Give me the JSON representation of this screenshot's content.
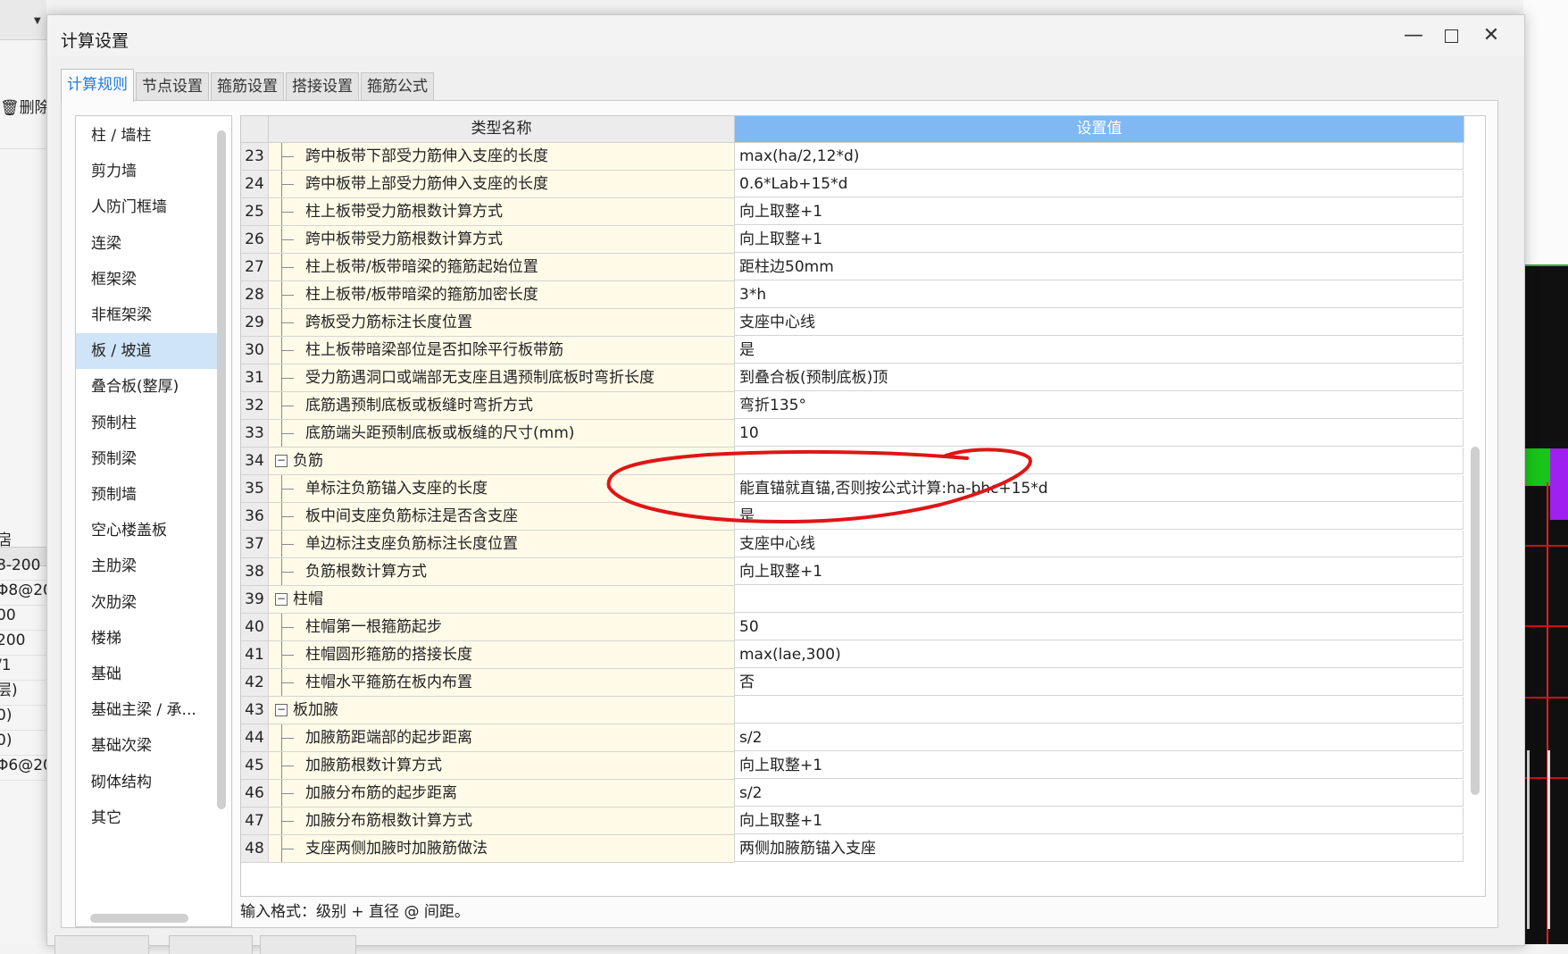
{
  "background": {
    "delete_label": "删除",
    "left_rows": [
      "扂",
      "8-200",
      "Φ8@20",
      "00",
      "200",
      "/1",
      "层)",
      "0)",
      "0)",
      "Φ6@20"
    ],
    "colors": {
      "dark": "#101010",
      "green": "#19c419",
      "purple": "#a020f0",
      "red": "#e02020"
    }
  },
  "dialog": {
    "title": "计算设置",
    "window_buttons": {
      "minimize": "—",
      "close": "✕"
    },
    "tabs": [
      {
        "label": "计算规则",
        "active": true
      },
      {
        "label": "节点设置"
      },
      {
        "label": "箍筋设置"
      },
      {
        "label": "搭接设置"
      },
      {
        "label": "箍筋公式"
      }
    ],
    "nav": {
      "items": [
        "柱 / 墙柱",
        "剪力墙",
        "人防门框墙",
        "连梁",
        "框架梁",
        "非框架梁",
        "板 / 坡道",
        "叠合板(整厚)",
        "预制柱",
        "预制梁",
        "预制墙",
        "空心楼盖板",
        "主肋梁",
        "次肋梁",
        "楼梯",
        "基础",
        "基础主梁 / 承...",
        "基础次梁",
        "砌体结构",
        "其它"
      ],
      "active_index": 6
    },
    "grid": {
      "headers": {
        "num": "",
        "name": "类型名称",
        "value": "设置值"
      },
      "rows": [
        {
          "num": "23",
          "name": "跨中板带下部受力筋伸入支座的长度",
          "value": "max(ha/2,12*d)"
        },
        {
          "num": "24",
          "name": "跨中板带上部受力筋伸入支座的长度",
          "value": "0.6*Lab+15*d"
        },
        {
          "num": "25",
          "name": "柱上板带受力筋根数计算方式",
          "value": "向上取整+1"
        },
        {
          "num": "26",
          "name": "跨中板带受力筋根数计算方式",
          "value": "向上取整+1"
        },
        {
          "num": "27",
          "name": "柱上板带/板带暗梁的箍筋起始位置",
          "value": "距柱边50mm"
        },
        {
          "num": "28",
          "name": "柱上板带/板带暗梁的箍筋加密长度",
          "value": "3*h"
        },
        {
          "num": "29",
          "name": "跨板受力筋标注长度位置",
          "value": "支座中心线"
        },
        {
          "num": "30",
          "name": "柱上板带暗梁部位是否扣除平行板带筋",
          "value": "是"
        },
        {
          "num": "31",
          "name": "受力筋遇洞口或端部无支座且遇预制底板时弯折长度",
          "value": "到叠合板(预制底板)顶"
        },
        {
          "num": "32",
          "name": "底筋遇预制底板或板缝时弯折方式",
          "value": "弯折135°"
        },
        {
          "num": "33",
          "name": "底筋端头距预制底板或板缝的尺寸(mm)",
          "value": "10"
        },
        {
          "num": "34",
          "name": "负筋",
          "value": "",
          "group": true
        },
        {
          "num": "35",
          "name": "单标注负筋锚入支座的长度",
          "value": "能直锚就直锚,否则按公式计算:ha-bhc+15*d"
        },
        {
          "num": "36",
          "name": "板中间支座负筋标注是否含支座",
          "value": "是"
        },
        {
          "num": "37",
          "name": "单边标注支座负筋标注长度位置",
          "value": "支座中心线"
        },
        {
          "num": "38",
          "name": "负筋根数计算方式",
          "value": "向上取整+1"
        },
        {
          "num": "39",
          "name": "柱帽",
          "value": "",
          "group": true
        },
        {
          "num": "40",
          "name": "柱帽第一根箍筋起步",
          "value": "50"
        },
        {
          "num": "41",
          "name": "柱帽圆形箍筋的搭接长度",
          "value": "max(lae,300)"
        },
        {
          "num": "42",
          "name": "柱帽水平箍筋在板内布置",
          "value": "否"
        },
        {
          "num": "43",
          "name": "板加腋",
          "value": "",
          "group": true
        },
        {
          "num": "44",
          "name": "加腋筋距端部的起步距离",
          "value": "s/2"
        },
        {
          "num": "45",
          "name": "加腋筋根数计算方式",
          "value": "向上取整+1"
        },
        {
          "num": "46",
          "name": "加腋分布筋的起步距离",
          "value": "s/2"
        },
        {
          "num": "47",
          "name": "加腋分布筋根数计算方式",
          "value": "向上取整+1"
        },
        {
          "num": "48",
          "name": "支座两侧加腋时加腋筋做法",
          "value": "两侧加腋筋锚入支座"
        }
      ]
    },
    "hint": "输入格式：级别 + 直径 @ 间距。",
    "colors": {
      "active_tab_text": "#1f7ee0",
      "header_value_bg": "#7fb8f3",
      "name_cell_bg": "#fffbe8",
      "nav_active_bg": "#cfe4f7",
      "annotation": "#e01515"
    }
  }
}
